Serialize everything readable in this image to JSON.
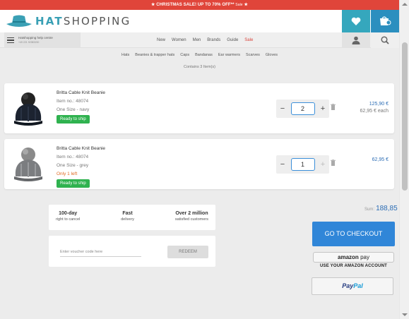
{
  "promo": {
    "text": "★ CHRISTMAS SALE! UP TO 70% OFF** ",
    "tag": "Sale",
    "star": " ★"
  },
  "brand": {
    "part1": "HAT",
    "part2": "SHOPPING"
  },
  "help": {
    "title": "Hatshopping help centre",
    "phone": "+49 221 92383230"
  },
  "nav": [
    "New",
    "Women",
    "Men",
    "Brands",
    "Guide"
  ],
  "nav_sale": "Sale",
  "subnav": [
    "Hats",
    "Beanies & trapper hats",
    "Caps",
    "Bandanas",
    "Ear warmers",
    "Scarves",
    "Gloves"
  ],
  "cart_info": "Contains 3 Item(s)",
  "items": [
    {
      "name": "Britta Cable Knit Beanie",
      "item_no": "Item no.: 48074",
      "variant": "One Size - navy",
      "stock": "",
      "ship": "Ready to ship",
      "qty": "2",
      "price": "125,90 €",
      "each": "62,95 € each"
    },
    {
      "name": "Britta Cable Knit Beanie",
      "item_no": "Item no.: 48074",
      "variant": "One Size - grey",
      "stock": "Only 1 left",
      "ship": "Ready to ship",
      "qty": "1",
      "price": "62,95 €",
      "each": ""
    }
  ],
  "usp": [
    {
      "big": "100-day",
      "small": "right to cancel"
    },
    {
      "big": "Fast",
      "small": "delivery"
    },
    {
      "big": "Over 2 million",
      "small": "satisfied customers"
    }
  ],
  "voucher": {
    "placeholder": "Enter voucher code here",
    "button": "REDEEM"
  },
  "sum": {
    "label": "Sum:",
    "value": "188,85 €"
  },
  "checkout": "GO TO CHECKOUT",
  "amazon": {
    "word1": "amazon",
    "word2": "pay",
    "caption": "USE YOUR AMAZON ACCOUNT"
  },
  "paypal": {
    "p1": "Pay",
    "p2": "Pal"
  },
  "colors": {
    "promo": "#e0453a",
    "teal": "#35a7bd",
    "checkout": "#3086d8",
    "ready": "#2fb24f",
    "price": "#2c6db5"
  }
}
